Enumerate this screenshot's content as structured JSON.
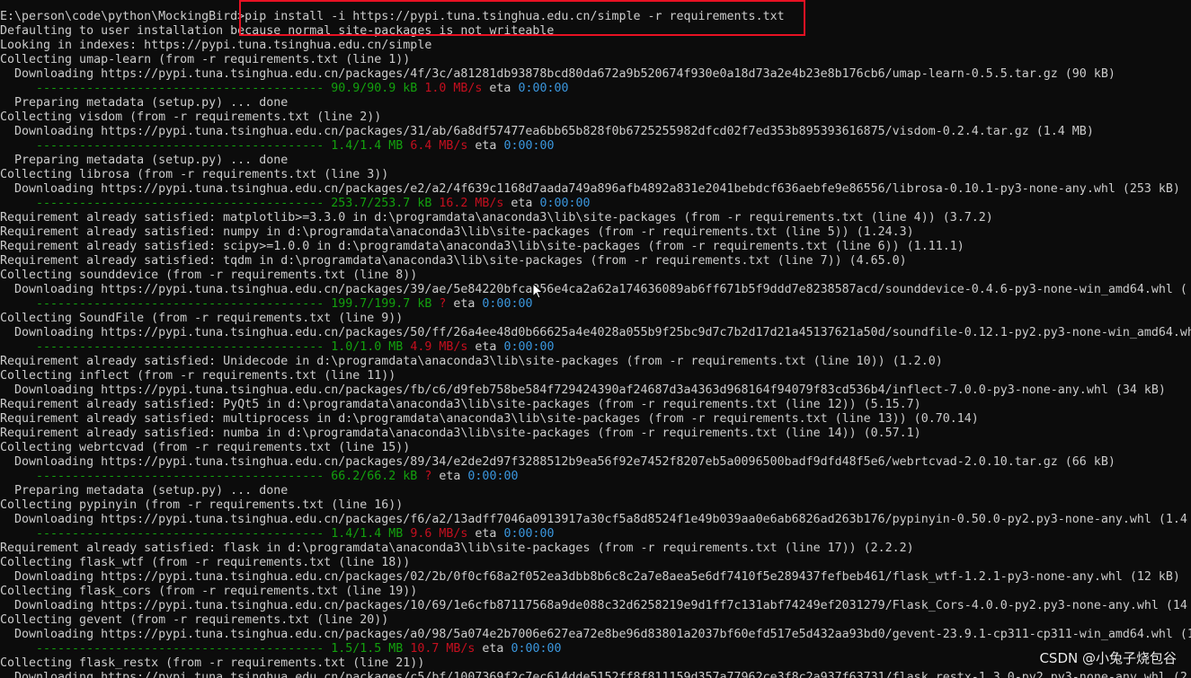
{
  "terminal": {
    "lines": [
      {
        "kind": "text",
        "text": "E:\\person\\code\\python\\MockingBird>pip install -i https://pypi.tuna.tsinghua.edu.cn/simple -r requirements.txt"
      },
      {
        "kind": "text",
        "text": "Defaulting to user installation because normal site-packages is not writeable"
      },
      {
        "kind": "text",
        "text": "Looking in indexes: https://pypi.tuna.tsinghua.edu.cn/simple"
      },
      {
        "kind": "text",
        "text": "Collecting umap-learn (from -r requirements.txt (line 1))"
      },
      {
        "kind": "text",
        "text": "  Downloading https://pypi.tuna.tsinghua.edu.cn/packages/4f/3c/a81281db93878bcd80da672a9b520674f930e0a18d73a2e4b23e8b176cb6/umap-learn-0.5.5.tar.gz (90 kB)"
      },
      {
        "kind": "progress",
        "bar": "     ---------------------------------------- ",
        "size": "90.9/90.9 kB",
        "speed": "1.0 MB/s",
        "eta": "eta",
        "time": "0:00:00"
      },
      {
        "kind": "text",
        "text": "  Preparing metadata (setup.py) ... done"
      },
      {
        "kind": "text",
        "text": "Collecting visdom (from -r requirements.txt (line 2))"
      },
      {
        "kind": "text",
        "text": "  Downloading https://pypi.tuna.tsinghua.edu.cn/packages/31/ab/6a8df57477ea6bb65b828f0b6725255982dfcd02f7ed353b895393616875/visdom-0.2.4.tar.gz (1.4 MB)"
      },
      {
        "kind": "progress",
        "bar": "     ---------------------------------------- ",
        "size": "1.4/1.4 MB",
        "speed": "6.4 MB/s",
        "eta": "eta",
        "time": "0:00:00"
      },
      {
        "kind": "text",
        "text": "  Preparing metadata (setup.py) ... done"
      },
      {
        "kind": "text",
        "text": "Collecting librosa (from -r requirements.txt (line 3))"
      },
      {
        "kind": "text",
        "text": "  Downloading https://pypi.tuna.tsinghua.edu.cn/packages/e2/a2/4f639c1168d7aada749a896afb4892a831e2041bebdcf636aebfe9e86556/librosa-0.10.1-py3-none-any.whl (253 kB)"
      },
      {
        "kind": "progress",
        "bar": "     ---------------------------------------- ",
        "size": "253.7/253.7 kB",
        "speed": "16.2 MB/s",
        "eta": "eta",
        "time": "0:00:00"
      },
      {
        "kind": "text",
        "text": "Requirement already satisfied: matplotlib>=3.3.0 in d:\\programdata\\anaconda3\\lib\\site-packages (from -r requirements.txt (line 4)) (3.7.2)"
      },
      {
        "kind": "text",
        "text": "Requirement already satisfied: numpy in d:\\programdata\\anaconda3\\lib\\site-packages (from -r requirements.txt (line 5)) (1.24.3)"
      },
      {
        "kind": "text",
        "text": "Requirement already satisfied: scipy>=1.0.0 in d:\\programdata\\anaconda3\\lib\\site-packages (from -r requirements.txt (line 6)) (1.11.1)"
      },
      {
        "kind": "text",
        "text": "Requirement already satisfied: tqdm in d:\\programdata\\anaconda3\\lib\\site-packages (from -r requirements.txt (line 7)) (4.65.0)"
      },
      {
        "kind": "text",
        "text": "Collecting sounddevice (from -r requirements.txt (line 8))"
      },
      {
        "kind": "text",
        "text": "  Downloading https://pypi.tuna.tsinghua.edu.cn/packages/39/ae/5e84220bfca256e4ca2a62a174636089ab6ff671b5f9ddd7e8238587acd/sounddevice-0.4.6-py3-none-win_amd64.whl ("
      },
      {
        "kind": "progress",
        "bar": "     ---------------------------------------- ",
        "size": "199.7/199.7 kB",
        "speed": "?",
        "eta": "eta",
        "time": "0:00:00"
      },
      {
        "kind": "text",
        "text": "Collecting SoundFile (from -r requirements.txt (line 9))"
      },
      {
        "kind": "text",
        "text": "  Downloading https://pypi.tuna.tsinghua.edu.cn/packages/50/ff/26a4ee48d0b66625a4e4028a055b9f25bc9d7c7b2d17d21a45137621a50d/soundfile-0.12.1-py2.py3-none-win_amd64.wh"
      },
      {
        "kind": "progress",
        "bar": "     ---------------------------------------- ",
        "size": "1.0/1.0 MB",
        "speed": "4.9 MB/s",
        "eta": "eta",
        "time": "0:00:00"
      },
      {
        "kind": "text",
        "text": "Requirement already satisfied: Unidecode in d:\\programdata\\anaconda3\\lib\\site-packages (from -r requirements.txt (line 10)) (1.2.0)"
      },
      {
        "kind": "text",
        "text": "Collecting inflect (from -r requirements.txt (line 11))"
      },
      {
        "kind": "text",
        "text": "  Downloading https://pypi.tuna.tsinghua.edu.cn/packages/fb/c6/d9feb758be584f729424390af24687d3a4363d968164f94079f83cd536b4/inflect-7.0.0-py3-none-any.whl (34 kB)"
      },
      {
        "kind": "text",
        "text": "Requirement already satisfied: PyQt5 in d:\\programdata\\anaconda3\\lib\\site-packages (from -r requirements.txt (line 12)) (5.15.7)"
      },
      {
        "kind": "text",
        "text": "Requirement already satisfied: multiprocess in d:\\programdata\\anaconda3\\lib\\site-packages (from -r requirements.txt (line 13)) (0.70.14)"
      },
      {
        "kind": "text",
        "text": "Requirement already satisfied: numba in d:\\programdata\\anaconda3\\lib\\site-packages (from -r requirements.txt (line 14)) (0.57.1)"
      },
      {
        "kind": "text",
        "text": "Collecting webrtcvad (from -r requirements.txt (line 15))"
      },
      {
        "kind": "text",
        "text": "  Downloading https://pypi.tuna.tsinghua.edu.cn/packages/89/34/e2de2d97f3288512b9ea56f92e7452f8207eb5a0096500badf9dfd48f5e6/webrtcvad-2.0.10.tar.gz (66 kB)"
      },
      {
        "kind": "progress",
        "bar": "     ---------------------------------------- ",
        "size": "66.2/66.2 kB",
        "speed": "?",
        "eta": "eta",
        "time": "0:00:00"
      },
      {
        "kind": "text",
        "text": "  Preparing metadata (setup.py) ... done"
      },
      {
        "kind": "text",
        "text": "Collecting pypinyin (from -r requirements.txt (line 16))"
      },
      {
        "kind": "text",
        "text": "  Downloading https://pypi.tuna.tsinghua.edu.cn/packages/f6/a2/13adff7046a0913917a30cf5a8d8524f1e49b039aa0e6ab6826ad263b176/pypinyin-0.50.0-py2.py3-none-any.whl (1.4"
      },
      {
        "kind": "progress",
        "bar": "     ---------------------------------------- ",
        "size": "1.4/1.4 MB",
        "speed": "9.6 MB/s",
        "eta": "eta",
        "time": "0:00:00"
      },
      {
        "kind": "text",
        "text": "Requirement already satisfied: flask in d:\\programdata\\anaconda3\\lib\\site-packages (from -r requirements.txt (line 17)) (2.2.2)"
      },
      {
        "kind": "text",
        "text": "Collecting flask_wtf (from -r requirements.txt (line 18))"
      },
      {
        "kind": "text",
        "text": "  Downloading https://pypi.tuna.tsinghua.edu.cn/packages/02/2b/0f0cf68a2f052ea3dbb8b6c8c2a7e8aea5e6df7410f5e289437fefbeb461/flask_wtf-1.2.1-py3-none-any.whl (12 kB)"
      },
      {
        "kind": "text",
        "text": "Collecting flask_cors (from -r requirements.txt (line 19))"
      },
      {
        "kind": "text",
        "text": "  Downloading https://pypi.tuna.tsinghua.edu.cn/packages/10/69/1e6cfb87117568a9de088c32d6258219e9d1ff7c131abf74249ef2031279/Flask_Cors-4.0.0-py2.py3-none-any.whl (14"
      },
      {
        "kind": "text",
        "text": "Collecting gevent (from -r requirements.txt (line 20))"
      },
      {
        "kind": "text",
        "text": "  Downloading https://pypi.tuna.tsinghua.edu.cn/packages/a0/98/5a074e2b7006e627ea72e8be96d83801a2037bf60efd517e5d432aa93bd0/gevent-23.9.1-cp311-cp311-win_amd64.whl (1"
      },
      {
        "kind": "progress",
        "bar": "     ---------------------------------------- ",
        "size": "1.5/1.5 MB",
        "speed": "10.7 MB/s",
        "eta": "eta",
        "time": "0:00:00"
      },
      {
        "kind": "text",
        "text": "Collecting flask_restx (from -r requirements.txt (line 21))"
      },
      {
        "kind": "text",
        "text": "  Downloading https://pypi.tuna.tsinghua.edu.cn/packages/c5/bf/1007369f2c7ec614dde5152ff8f811159d357a77962ce3f8c2a937f63731/flask_restx-1.3.0-py2.py3-none-any.whl (2"
      }
    ]
  },
  "watermark": "CSDN @小兔子烧包谷",
  "colors": {
    "background": "#0c0c0c",
    "text": "#cccccc",
    "progress_green": "#13a10e",
    "speed_red": "#c50f1f",
    "time_blue": "#3a96dd",
    "highlight_border": "#e81123"
  }
}
